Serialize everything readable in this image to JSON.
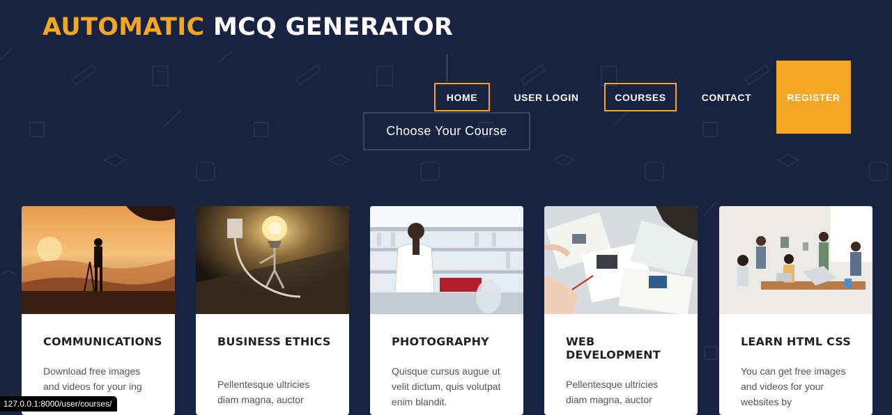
{
  "logo": {
    "accent": "AUTOMATIC",
    "rest": " MCQ GENERATOR"
  },
  "nav": {
    "home": "HOME",
    "user_login": "USER LOGIN",
    "courses": "COURSES",
    "contact": "CONTACT",
    "register": "REGISTER"
  },
  "choose_course": "Choose Your Course",
  "courses": [
    {
      "title": "COMMUNICATIONS",
      "description": "Download free images and videos for your  ing"
    },
    {
      "title": "BUSINESS ETHICS",
      "description": "Pellentesque ultricies diam magna, auctor"
    },
    {
      "title": "PHOTOGRAPHY",
      "description": "Quisque cursus augue ut velit dictum, quis volutpat enim blandit."
    },
    {
      "title": "WEB DEVELOPMENT",
      "description": "Pellentesque ultricies diam magna, auctor"
    },
    {
      "title": "LEARN HTML CSS",
      "description": "You can get free images and videos for your websites by"
    }
  ],
  "status_url": "127.0.0.1:8000/user/courses/",
  "colors": {
    "background": "#172340",
    "accent": "#f5a623",
    "card": "#ffffff"
  },
  "icons": [
    "ruler-icon",
    "calculator-icon",
    "pencil-icon",
    "book-icon",
    "graduation-cap-icon",
    "backpack-icon"
  ]
}
